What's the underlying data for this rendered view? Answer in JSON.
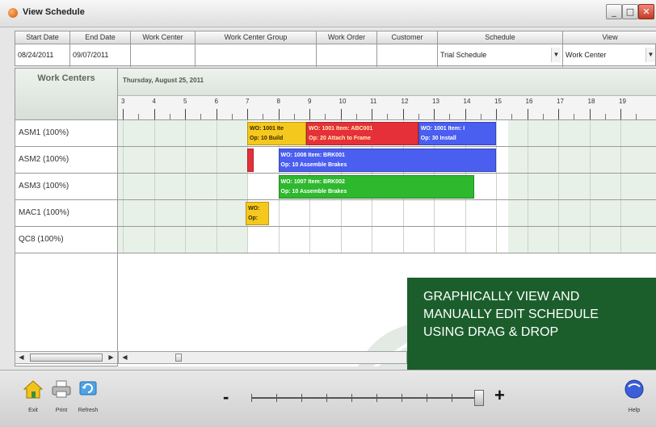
{
  "window": {
    "title": "View Schedule",
    "minimize": "_",
    "maximize": "□",
    "close": "✕"
  },
  "filters": [
    {
      "header": "Start Date",
      "value": "08/24/2011"
    },
    {
      "header": "End Date",
      "value": "09/07/2011"
    },
    {
      "header": "Work Center",
      "value": ""
    },
    {
      "header": "Work Center Group",
      "value": ""
    },
    {
      "header": "Work Order",
      "value": ""
    },
    {
      "header": "Customer",
      "value": ""
    },
    {
      "header": "Schedule",
      "value": "Trial Schedule",
      "dropdown": true
    },
    {
      "header": "View",
      "value": "Work Center",
      "dropdown": true
    }
  ],
  "work_centers": {
    "title": "Work Centers",
    "rows": [
      "ASM1  (100%)",
      "ASM2  (100%)",
      "ASM3  (100%)",
      "MAC1  (100%)",
      "QC8  (100%)"
    ]
  },
  "timeline": {
    "date": "Thursday, August 25, 2011",
    "hours": [
      "3",
      "4",
      "5",
      "6",
      "7",
      "8",
      "9",
      "10",
      "11",
      "12",
      "13",
      "14",
      "15",
      "16",
      "17",
      "18",
      "19"
    ]
  },
  "bars": [
    {
      "row": 0,
      "start": 7.0,
      "end": 8.9,
      "color": "#f5c81e",
      "text_color": "#3a2a00",
      "line1": "WO: 1001  Ite",
      "line2": "Op: 10 Build"
    },
    {
      "row": 0,
      "start": 8.9,
      "end": 12.5,
      "color": "#e5303a",
      "text_color": "#fff3b0",
      "line1": "WO: 1001  Item: ABC001",
      "line2": "Op: 20 Attach to Frame"
    },
    {
      "row": 0,
      "start": 12.5,
      "end": 15.0,
      "color": "#4a5ef0",
      "text_color": "#ffffff",
      "line1": "WO: 1001  Item: I",
      "line2": "Op: 30 Install"
    },
    {
      "row": 1,
      "start": 7.0,
      "end": 7.2,
      "color": "#e5303a",
      "text_color": "#ffffff",
      "line1": "",
      "line2": ""
    },
    {
      "row": 1,
      "start": 8.0,
      "end": 15.0,
      "color": "#4a5ef0",
      "text_color": "#ffffff",
      "line1": "WO: 1008  Item: BRK001",
      "line2": "Op: 10 Assemble Brakes"
    },
    {
      "row": 2,
      "start": 8.0,
      "end": 14.3,
      "color": "#2eb82e",
      "text_color": "#ffffff",
      "line1": "WO: 1007  Item: BRK002",
      "line2": "Op: 10 Assemble Brakes"
    },
    {
      "row": 3,
      "start": 6.95,
      "end": 7.7,
      "color": "#f5c81e",
      "text_color": "#3a2a00",
      "line1": "WO:",
      "line2": "Op:"
    }
  ],
  "banner": {
    "line1": "GRAPHICALLY VIEW AND",
    "line2": "MANUALLY EDIT SCHEDULE",
    "line3": "USING DRAG & DROP"
  },
  "toolbar": {
    "exit_label": "Exit",
    "print_label": "Print",
    "refresh_label": "Refresh",
    "help_label": "Help",
    "zoom_minus": "-",
    "zoom_plus": "+",
    "zoom_level": 1.0
  },
  "colors": {
    "banner_bg": "#1b5e2c",
    "nonworking_shade": "#e8f1e8"
  }
}
